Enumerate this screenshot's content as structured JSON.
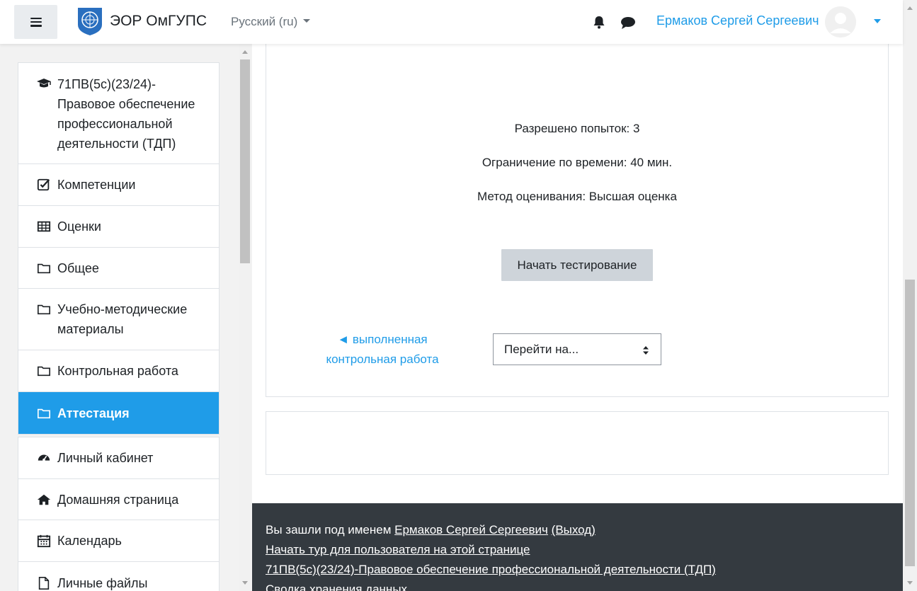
{
  "header": {
    "site_name": "ЭОР ОмГУПС",
    "language": "Русский (ru)",
    "user_name": "Ермаков Сергей Сергеевич",
    "icons": [
      "hamburger-icon",
      "bell-icon",
      "chat-icon",
      "avatar-icon"
    ]
  },
  "sidebar": {
    "course": "71ПВ(5с)(23/24)-Правовое обеспечение профессиональной деятельности (ТДП)",
    "items": [
      {
        "label": "Компетенции",
        "icon": "check-square-icon"
      },
      {
        "label": "Оценки",
        "icon": "table-icon"
      },
      {
        "label": "Общее",
        "icon": "folder-icon"
      },
      {
        "label": "Учебно-методические материалы",
        "icon": "folder-icon"
      },
      {
        "label": "Контрольная работа",
        "icon": "folder-icon"
      },
      {
        "label": "Аттестация",
        "icon": "folder-icon",
        "active": true
      }
    ],
    "items2": [
      {
        "label": "Личный кабинет",
        "icon": "dashboard-icon"
      },
      {
        "label": "Домашняя страница",
        "icon": "home-icon"
      },
      {
        "label": "Календарь",
        "icon": "calendar-icon"
      },
      {
        "label": "Личные файлы",
        "icon": "file-icon"
      }
    ]
  },
  "quiz": {
    "attempts": "Разрешено попыток: 3",
    "time_limit": "Ограничение по времени: 40 мин.",
    "grading": "Метод оценивания: Высшая оценка",
    "start_button": "Начать тестирование",
    "prev_link": "◄ выполненная контрольная работа",
    "jump_select": "Перейти на..."
  },
  "footer": {
    "logged_in_prefix": "Вы зашли под именем ",
    "user_link": "Ермаков Сергей Сергеевич",
    "logout": "(Выход)",
    "tour": "Начать тур для пользователя на этой странице",
    "course_link": "71ПВ(5с)(23/24)-Правовое обеспечение профессиональной деятельности (ТДП)",
    "data_retention": "Сводка хранения данных"
  },
  "colors": {
    "accent": "#1f9ce8",
    "footer_bg": "#343a40",
    "button_bg": "#ced4da"
  }
}
